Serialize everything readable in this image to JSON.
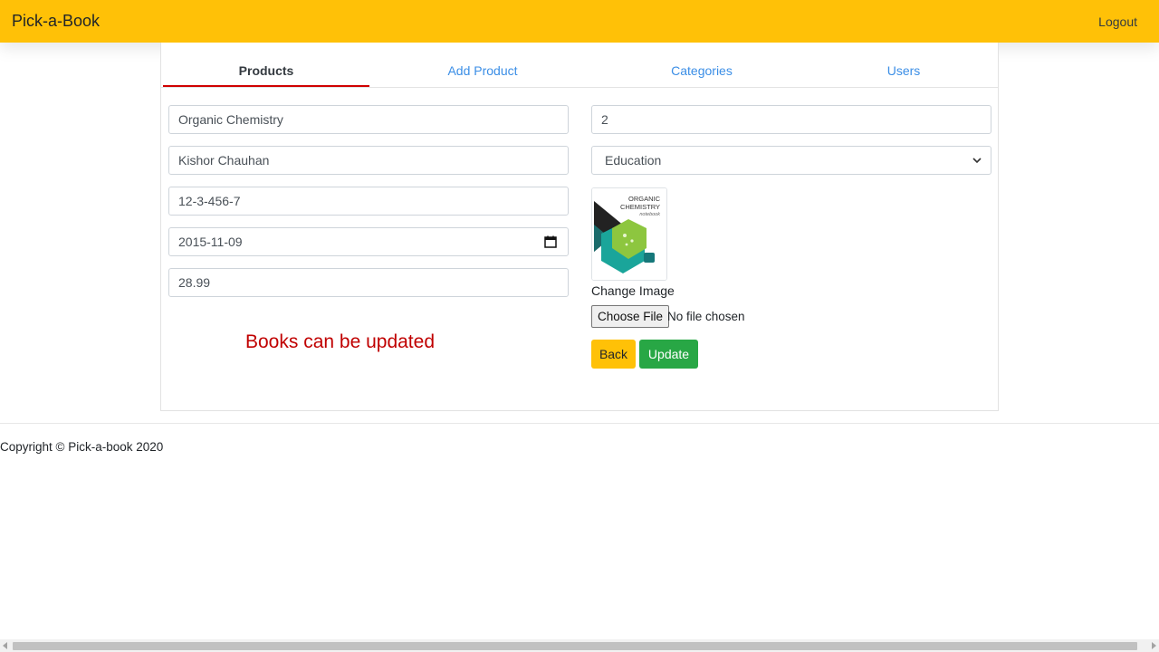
{
  "navbar": {
    "brand": "Pick-a-Book",
    "logout": "Logout",
    "color": "#ffc107"
  },
  "tabs": [
    {
      "label": "Products",
      "active": true
    },
    {
      "label": "Add Product",
      "active": false
    },
    {
      "label": "Categories",
      "active": false
    },
    {
      "label": "Users",
      "active": false
    }
  ],
  "form": {
    "title": "Organic Chemistry",
    "author": "Kishor Chauhan",
    "isbn": "12-3-456-7",
    "date": "2015-11-09",
    "price": "28.99",
    "quantity": "2",
    "category": "Education",
    "change_image_label": "Change Image",
    "choose_file": "Choose File",
    "file_status": "No file chosen",
    "back": "Back",
    "update": "Update"
  },
  "book_cover": {
    "line1": "ORGANIC",
    "line2": "CHEMISTRY",
    "line3": "notebook"
  },
  "note": "Books can be updated",
  "footer": {
    "copyright": "Copyright © Pick-a-book 2020"
  }
}
